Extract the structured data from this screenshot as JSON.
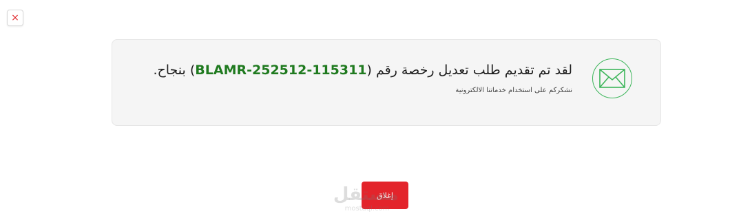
{
  "dialog": {
    "close_icon": "×"
  },
  "message": {
    "before_ref": "لقد تم تقديم طلب تعديل رخصة رقم (",
    "reference": "BLAMR-252512-115311",
    "after_ref": ") بنجاح.",
    "subtitle": "نشكركم على استخدام خدماتنا الالكترونية",
    "icon": "envelope-icon",
    "icon_color": "#3cb55a",
    "reference_color": "#1f7a1f"
  },
  "actions": {
    "close_label": "إغلاق",
    "close_color": "#e3242b"
  },
  "watermark": {
    "arabic": "مستقل",
    "latin": "mostaql.com"
  }
}
